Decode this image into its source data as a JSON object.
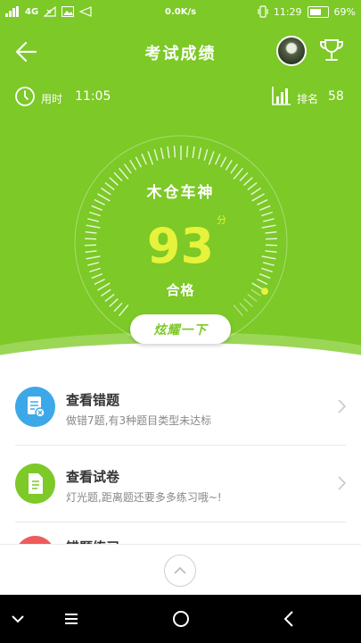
{
  "status_bar": {
    "network_label": "4G",
    "net_speed": "0.0K/s",
    "time": "11:29",
    "battery": "69%"
  },
  "header": {
    "title": "考试成绩",
    "back_icon": "back-arrow-icon",
    "trophy_icon": "trophy-icon"
  },
  "stats": {
    "time_label": "用时",
    "time_value": "11:05",
    "rank_label": "排名",
    "rank_value": "58"
  },
  "result": {
    "rank_name": "木仓车神",
    "score": "93",
    "unit": "分",
    "verdict": "合格",
    "score_fraction": 0.93,
    "share_button": "炫耀一下"
  },
  "list": {
    "items": [
      {
        "title": "查看错题",
        "desc": "做错7题,有3种题目类型未达标",
        "icon": "wrong-questions-icon",
        "color": "#3da8e8"
      },
      {
        "title": "查看试卷",
        "desc": "灯光题,距离题还要多多练习哦~!",
        "icon": "exam-paper-icon",
        "color": "#7cc927"
      },
      {
        "title": "错题练习",
        "icon": "practice-icon",
        "color": "#ef5b5b"
      }
    ]
  },
  "colors": {
    "accent": "#7cc927",
    "score": "#e6f23b"
  }
}
